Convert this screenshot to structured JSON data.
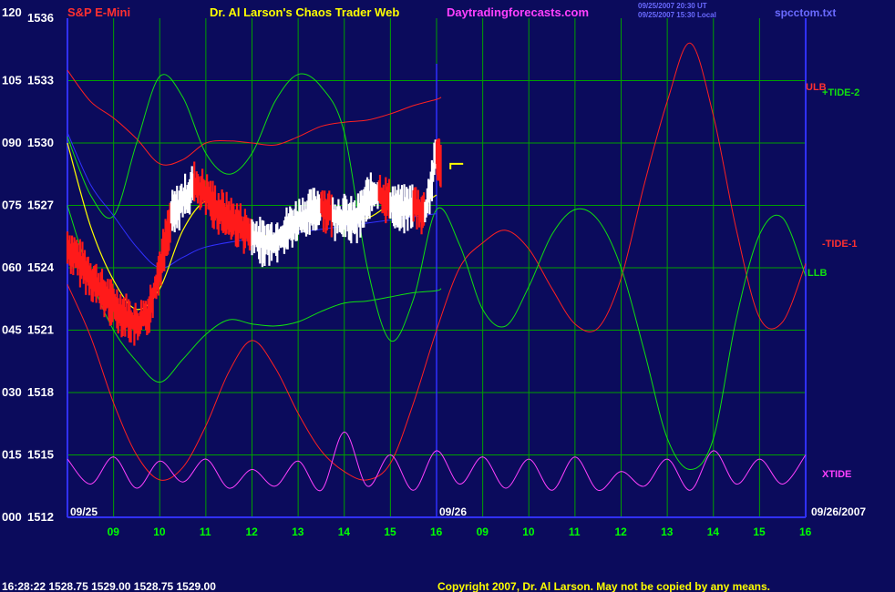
{
  "header": {
    "instrument": "S&P E-Mini",
    "title": "Dr. Al Larson's Chaos Trader Web",
    "website": "Daytradingforecasts.com",
    "timestamp_ut": "09/25/2007 20:30 UT",
    "timestamp_local": "09/25/2007 15:30 Local",
    "data_file": "spcctom.txt"
  },
  "footer": {
    "quote": "16:28:22  1528.75 1529.00 1528.75 1529.00",
    "copyright": "Copyright 2007, Dr. Al Larson. May not be copied by any means."
  },
  "colors": {
    "background": "#0b0b5c",
    "grid": "#00a000",
    "price": "#ffffff",
    "price_down": "#ff1a1a",
    "axis_text": "#ffffff",
    "hour_text": "#00ff00",
    "red_line": "#ff2020",
    "green_line": "#10e010",
    "blue_line": "#3030ff",
    "magenta_line": "#ff40ff",
    "yellow_line": "#ffff00"
  },
  "chart_data": {
    "type": "line",
    "title": "S&P E-Mini",
    "y_left_labels": [
      "120",
      "105",
      "090",
      "075",
      "060",
      "045",
      "030",
      "015",
      "000"
    ],
    "y_right_prices": [
      "1536",
      "1533",
      "1530",
      "1527",
      "1524",
      "1521",
      "1518",
      "1515",
      "1512"
    ],
    "y_price_range": [
      1512,
      1536
    ],
    "x_hour_labels": [
      "09",
      "10",
      "11",
      "12",
      "13",
      "14",
      "15",
      "16",
      "09",
      "10",
      "11",
      "12",
      "13",
      "14",
      "15",
      "16"
    ],
    "date_labels": {
      "start": "09/25",
      "mid": "09/26",
      "end": "09/26/2007"
    },
    "series_labels": {
      "ulb": "ULB",
      "tide2": "+TIDE-2",
      "tide1": "-TIDE-1",
      "llb": "LLB",
      "xtide": "XTIDE"
    },
    "series": [
      {
        "name": "price",
        "x": [
          8.0,
          8.25,
          8.5,
          8.75,
          9.0,
          9.25,
          9.5,
          9.75,
          10.0,
          10.25,
          10.5,
          10.75,
          11.0,
          11.25,
          11.5,
          11.75,
          12.0,
          12.25,
          12.5,
          12.75,
          13.0,
          13.25,
          13.5,
          13.75,
          14.0,
          14.25,
          14.5,
          14.75,
          15.0,
          15.25,
          15.5,
          15.75,
          16.0,
          16.1
        ],
        "y": [
          1525.0,
          1524.3,
          1523.6,
          1522.8,
          1522.2,
          1521.7,
          1521.2,
          1521.8,
          1524.0,
          1526.5,
          1527.2,
          1528.0,
          1527.5,
          1526.8,
          1526.4,
          1526.0,
          1525.5,
          1525.2,
          1525.3,
          1525.8,
          1526.3,
          1526.6,
          1527.0,
          1526.5,
          1526.4,
          1526.2,
          1527.3,
          1527.6,
          1527.1,
          1526.8,
          1527.0,
          1526.6,
          1529.4,
          1529.0
        ]
      },
      {
        "name": "ULB",
        "x": [
          8.0,
          8.5,
          9.0,
          9.5,
          10.0,
          10.5,
          11.0,
          11.5,
          12.0,
          12.5,
          13.0,
          13.5,
          14.0,
          14.5,
          15.0,
          15.5,
          16.0,
          16.1
        ],
        "y": [
          1533.5,
          1532.0,
          1531.2,
          1530.2,
          1529.0,
          1529.2,
          1530.0,
          1530.1,
          1530.0,
          1529.9,
          1530.3,
          1530.8,
          1531.0,
          1531.1,
          1531.4,
          1531.8,
          1532.1,
          1532.2
        ]
      },
      {
        "name": "LLB",
        "x": [
          8.0,
          8.5,
          9.0,
          9.5,
          10.0,
          10.5,
          11.0,
          11.5,
          12.0,
          12.5,
          13.0,
          13.5,
          14.0,
          14.5,
          15.0,
          15.5,
          16.0,
          16.1
        ],
        "y": [
          1527.0,
          1523.5,
          1521.0,
          1519.5,
          1518.5,
          1519.6,
          1520.8,
          1521.5,
          1521.3,
          1521.2,
          1521.4,
          1521.9,
          1522.3,
          1522.4,
          1522.6,
          1522.8,
          1522.9,
          1523.0
        ]
      },
      {
        "name": "-TIDE-1",
        "x": [
          8.0,
          8.5,
          9.0,
          9.5,
          10.0,
          10.5,
          11.0,
          11.5,
          12.0,
          12.5,
          13.0,
          13.5,
          14.0,
          14.5,
          15.0,
          15.5,
          16.0,
          16.5,
          17.0,
          17.5,
          18.0,
          18.5,
          19.0,
          19.5,
          20.0,
          20.5,
          21.0,
          21.5,
          22.0,
          22.5,
          23.0,
          23.5,
          24.0
        ],
        "y": [
          1523.2,
          1520.7,
          1517.5,
          1515.0,
          1513.8,
          1514.4,
          1516.4,
          1519.0,
          1520.5,
          1519.2,
          1517.0,
          1515.2,
          1514.2,
          1513.8,
          1514.6,
          1517.5,
          1521.0,
          1524.0,
          1525.2,
          1525.8,
          1524.9,
          1523.0,
          1521.3,
          1521.1,
          1523.5,
          1528.0,
          1532.0,
          1534.8,
          1531.3,
          1525.8,
          1521.6,
          1521.4,
          1524.2
        ]
      },
      {
        "name": "+TIDE-2",
        "x": [
          8.0,
          8.5,
          9.0,
          9.5,
          10.0,
          10.5,
          11.0,
          11.5,
          12.0,
          12.5,
          13.0,
          13.5,
          14.0,
          14.5,
          15.0,
          15.5,
          16.0,
          16.5,
          17.0,
          17.5,
          18.0,
          18.5,
          19.0,
          19.5,
          20.0,
          20.5,
          21.0,
          21.5,
          22.0,
          22.5,
          23.0,
          23.5,
          24.0
        ],
        "y": [
          1530.3,
          1527.5,
          1526.5,
          1530.0,
          1533.2,
          1532.2,
          1529.5,
          1528.5,
          1529.5,
          1532.0,
          1533.3,
          1532.7,
          1530.5,
          1524.0,
          1520.5,
          1522.5,
          1526.8,
          1525.1,
          1522.0,
          1521.2,
          1523.1,
          1525.6,
          1526.8,
          1526.3,
          1524.0,
          1520.0,
          1515.8,
          1514.3,
          1515.8,
          1521.6,
          1525.6,
          1526.4,
          1523.6
        ]
      },
      {
        "name": "XTIDE",
        "x": [
          8.0,
          8.5,
          9.0,
          9.5,
          10.0,
          10.5,
          11.0,
          11.5,
          12.0,
          12.5,
          13.0,
          13.5,
          14.0,
          14.5,
          15.0,
          15.5,
          16.0,
          16.5,
          17.0,
          17.5,
          18.0,
          18.5,
          19.0,
          19.5,
          20.0,
          20.5,
          21.0,
          21.5,
          22.0,
          22.5,
          23.0,
          23.5,
          24.0
        ],
        "y": [
          1514.8,
          1513.6,
          1514.9,
          1513.4,
          1514.7,
          1513.7,
          1514.8,
          1513.4,
          1514.3,
          1513.5,
          1514.7,
          1513.3,
          1516.1,
          1513.5,
          1515.0,
          1513.3,
          1515.2,
          1513.6,
          1514.9,
          1513.4,
          1514.8,
          1513.3,
          1514.9,
          1513.3,
          1514.2,
          1513.5,
          1514.8,
          1513.3,
          1515.2,
          1513.6,
          1514.8,
          1513.6,
          1515.0
        ]
      },
      {
        "name": "blue_line",
        "x": [
          8.0,
          8.5,
          9.0,
          9.5,
          10.0,
          10.5,
          11.0,
          12.0,
          13.0,
          14.0,
          15.0,
          16.0
        ],
        "y": [
          1530.5,
          1528.0,
          1526.5,
          1525.0,
          1524.0,
          1524.5,
          1525.0,
          1525.4,
          1525.7,
          1526.0,
          1526.3,
          1526.6
        ]
      },
      {
        "name": "yellow_line",
        "x": [
          8.0,
          8.5,
          9.0,
          9.5,
          10.0,
          10.5,
          11.0,
          11.5,
          12.0,
          12.5,
          13.0,
          13.5,
          14.0,
          14.5,
          15.0,
          15.5,
          16.0
        ],
        "y": [
          1530.0,
          1526.0,
          1523.4,
          1522.0,
          1523.0,
          1525.8,
          1527.2,
          1526.6,
          1525.8,
          1525.5,
          1526.0,
          1526.5,
          1526.6,
          1526.4,
          1527.0,
          1526.9,
          1527.5
        ]
      }
    ]
  }
}
